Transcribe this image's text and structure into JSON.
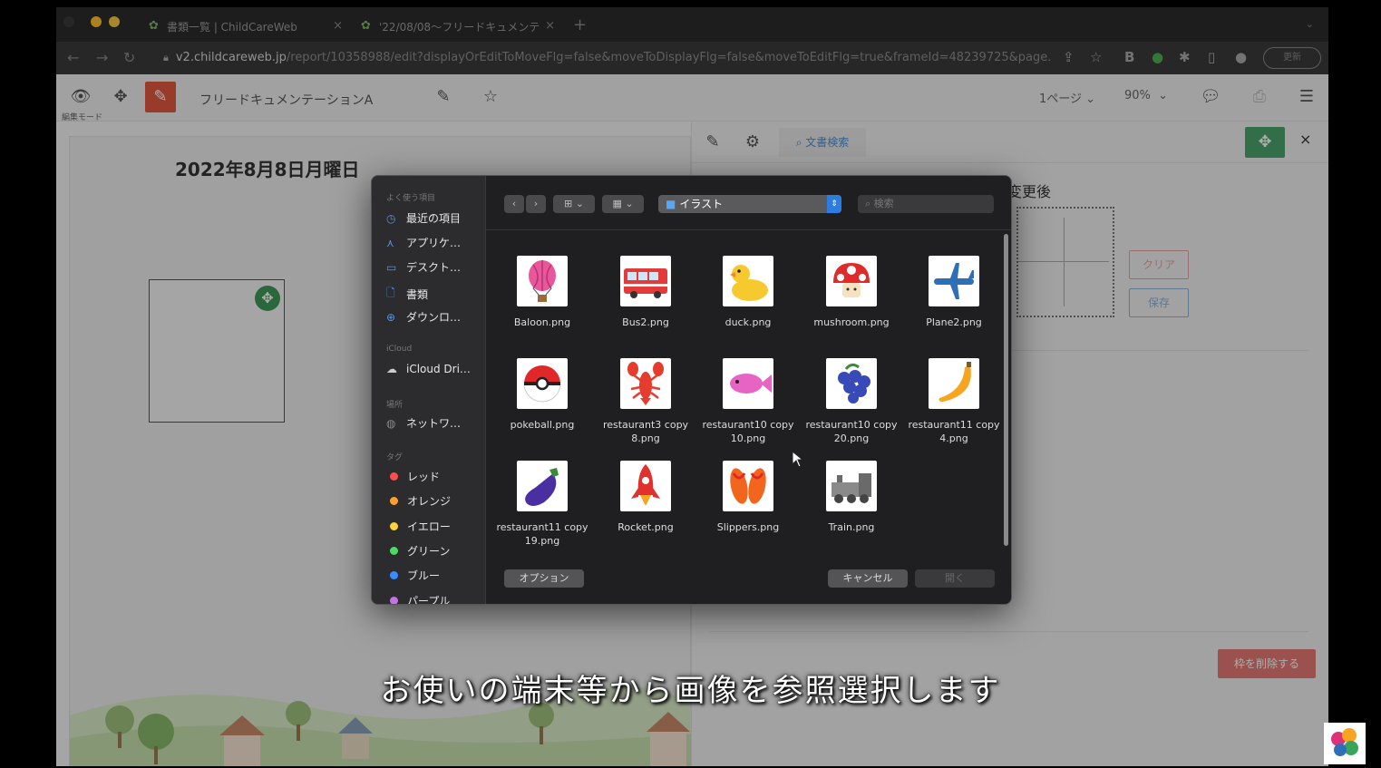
{
  "browser": {
    "tabs": [
      {
        "title": "書類一覧 | ChildCareWeb",
        "close": "×"
      },
      {
        "title": "'22/08/08〜フリードキュメンテ",
        "close": "×"
      }
    ],
    "new_tab": "+",
    "url_host": "v2.childcareweb.jp",
    "url_path": "/report/10358988/edit?displayOrEditToMoveFlg=false&moveToDisplayFlg=false&moveToEditFlg=true&frameId=48239725&page...",
    "profile_label": "更新"
  },
  "app": {
    "mode_label": "編集モード",
    "doc_title": "フリードキュメンテーションA",
    "page_select": "1ページ",
    "zoom_select": "90%"
  },
  "document": {
    "date": "2022年8月8日月曜日"
  },
  "panel": {
    "search_label": "文書検索",
    "after_label": "変更後",
    "clear_label": "クリア",
    "save_label": "保存",
    "delete_frame_label": "枠を削除する",
    "close_label": "×"
  },
  "dialog": {
    "folder": "イラスト",
    "search_placeholder": "検索",
    "sidebar": {
      "favorites_header": "よく使う項目",
      "favorites": [
        {
          "label": "最近の項目",
          "icon": "clock-icon"
        },
        {
          "label": "アプリケ…",
          "icon": "apps-icon"
        },
        {
          "label": "デスクト…",
          "icon": "desktop-icon"
        },
        {
          "label": "書類",
          "icon": "document-icon"
        },
        {
          "label": "ダウンロ…",
          "icon": "download-icon"
        }
      ],
      "icloud_header": "iCloud",
      "icloud": [
        {
          "label": "iCloud Dri…",
          "icon": "cloud-icon"
        }
      ],
      "locations_header": "場所",
      "locations": [
        {
          "label": "ネットワ…",
          "icon": "network-icon"
        }
      ],
      "tags_header": "タグ",
      "tags": [
        {
          "label": "レッド",
          "color": "#ff4d4d"
        },
        {
          "label": "オレンジ",
          "color": "#ffa02e"
        },
        {
          "label": "イエロー",
          "color": "#ffd43b"
        },
        {
          "label": "グリーン",
          "color": "#4cd964"
        },
        {
          "label": "ブルー",
          "color": "#3b8cff"
        },
        {
          "label": "パープル",
          "color": "#c472e8"
        }
      ]
    },
    "files": [
      {
        "name": "Baloon.png",
        "icon": "balloon-icon"
      },
      {
        "name": "Bus2.png",
        "icon": "bus-icon"
      },
      {
        "name": "duck.png",
        "icon": "duck-icon"
      },
      {
        "name": "mushroom.png",
        "icon": "mushroom-icon"
      },
      {
        "name": "Plane2.png",
        "icon": "plane-icon"
      },
      {
        "name": "pokeball.png",
        "icon": "pokeball-icon"
      },
      {
        "name": "restaurant3 copy 8.png",
        "icon": "lobster-icon"
      },
      {
        "name": "restaurant10 copy 10.png",
        "icon": "fish-icon"
      },
      {
        "name": "restaurant10 copy 20.png",
        "icon": "grapes-icon"
      },
      {
        "name": "restaurant11 copy 4.png",
        "icon": "banana-icon"
      },
      {
        "name": "restaurant11 copy 19.png",
        "icon": "eggplant-icon"
      },
      {
        "name": "Rocket.png",
        "icon": "rocket-icon"
      },
      {
        "name": "Slippers.png",
        "icon": "slippers-icon"
      },
      {
        "name": "Train.png",
        "icon": "train-icon"
      }
    ],
    "options_label": "オプション",
    "cancel_label": "キャンセル",
    "open_label": "開く"
  },
  "subtitle": "お使いの端末等から画像を参照選択します"
}
